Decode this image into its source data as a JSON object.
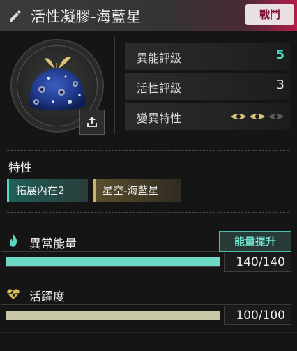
{
  "header": {
    "title": "活性凝膠-海藍星",
    "badge": "戰鬥"
  },
  "stats": {
    "ability_grade_label": "異能評級",
    "ability_grade_value": "5",
    "activity_grade_label": "活性評級",
    "activity_grade_value": "3",
    "mutation_label": "變異特性",
    "mutation_eyes_active": 2,
    "mutation_eyes_total": 3
  },
  "traits": {
    "title": "特性",
    "tags": [
      "拓展內在2",
      "星空-海藍星"
    ]
  },
  "energy": {
    "label": "異常能量",
    "upgrade_button": "能量提升",
    "current": 140,
    "max": 140,
    "display": "140/140",
    "color": "#6ed9c6"
  },
  "vitality": {
    "label": "活躍度",
    "current": 100,
    "max": 100,
    "display": "100/100",
    "color": "#c8c8a6"
  },
  "icons": {
    "edit": "pencil-icon",
    "export": "export-icon",
    "energy": "flame-icon",
    "vitality": "heartbeat-icon",
    "mutation": "eye-icon"
  }
}
